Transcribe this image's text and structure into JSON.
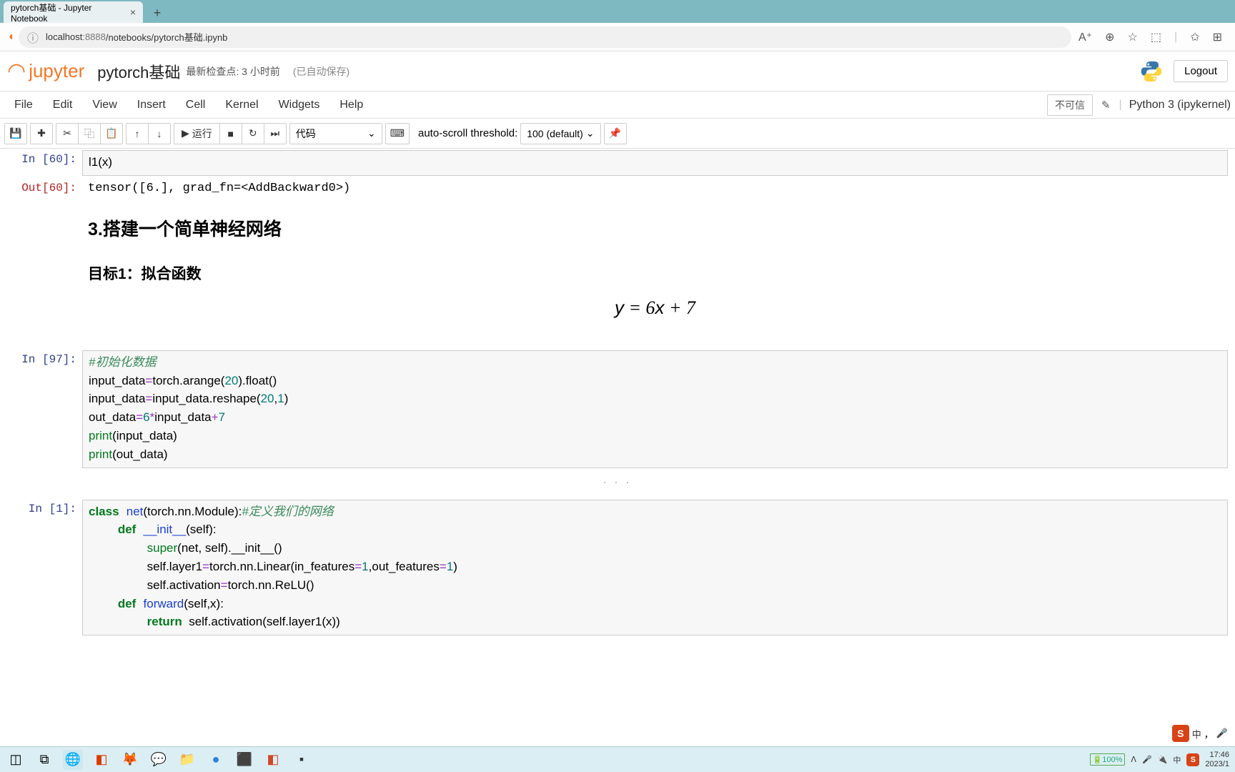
{
  "browser": {
    "tab_title": "pytorch基础 - Jupyter Notebook",
    "url_host": "localhost",
    "url_port": ":8888",
    "url_path": "/notebooks/pytorch基础.ipynb"
  },
  "header": {
    "logo_text": "jupyter",
    "notebook_name": "pytorch基础",
    "checkpoint": "最新检查点: 3 小时前",
    "autosave": "(已自动保存)",
    "logout": "Logout"
  },
  "menu": {
    "items": [
      "File",
      "Edit",
      "View",
      "Insert",
      "Cell",
      "Kernel",
      "Widgets",
      "Help"
    ],
    "trust": "不可信",
    "kernel": "Python 3 (ipykernel)"
  },
  "toolbar": {
    "run_label": "运行",
    "cell_type": "代码",
    "autoscroll_label": "auto-scroll threshold:",
    "autoscroll_value": "100 (default)"
  },
  "cells": {
    "c0": {
      "prompt": "In [60]:",
      "code_plain": "l1(x)"
    },
    "c1": {
      "prompt": "Out[60]:",
      "output": "tensor([6.], grad_fn=<AddBackward0>)"
    },
    "md": {
      "h2": "3.搭建一个简单神经网络",
      "h3": "目标1：拟合函数",
      "formula": "y = 6x + 7"
    },
    "c2": {
      "prompt": "In [97]:"
    },
    "c3": {
      "prompt": "In  [1]:"
    },
    "ellipsis": ". . ."
  },
  "code97": {
    "l1_comment": "#初始化数据",
    "l2_a": "input_data",
    "l2_b": "torch.arange(",
    "l2_c": "20",
    "l2_d": ").float()",
    "l3_a": "input_data",
    "l3_b": "input_data.reshape(",
    "l3_c": "20",
    "l3_d": ",",
    "l3_e": "1",
    "l3_f": ")",
    "l4_a": "out_data",
    "l4_b": "6",
    "l4_c": "input_data",
    "l4_d": "7",
    "l5_a": "print",
    "l5_b": "(input_data)",
    "l6_a": "print",
    "l6_b": "(out_data)"
  },
  "code1": {
    "l1_a": "class",
    "l1_b": "net",
    "l1_c": "(torch.nn.Module):",
    "l1_d": "#定义我们的网络",
    "l2_a": "def",
    "l2_b": "__init__",
    "l2_c": "(self):",
    "l3_a": "super",
    "l3_b": "(net, self).__init__()",
    "l4_a": "self.layer1",
    "l4_b": "torch.nn.Linear(in_features",
    "l4_c": "1",
    "l4_d": ",out_features",
    "l4_e": "1",
    "l4_f": ")",
    "l5_a": "self.activation",
    "l5_b": "torch.nn.ReLU()",
    "l6_a": "def",
    "l6_b": "forward",
    "l6_c": "(self,x):",
    "l7_a": "return",
    "l7_b": "  self.activation(self.layer1(x))"
  },
  "tray": {
    "battery": "100%",
    "time": "17:46",
    "date": "2023/1",
    "ime": "中"
  }
}
